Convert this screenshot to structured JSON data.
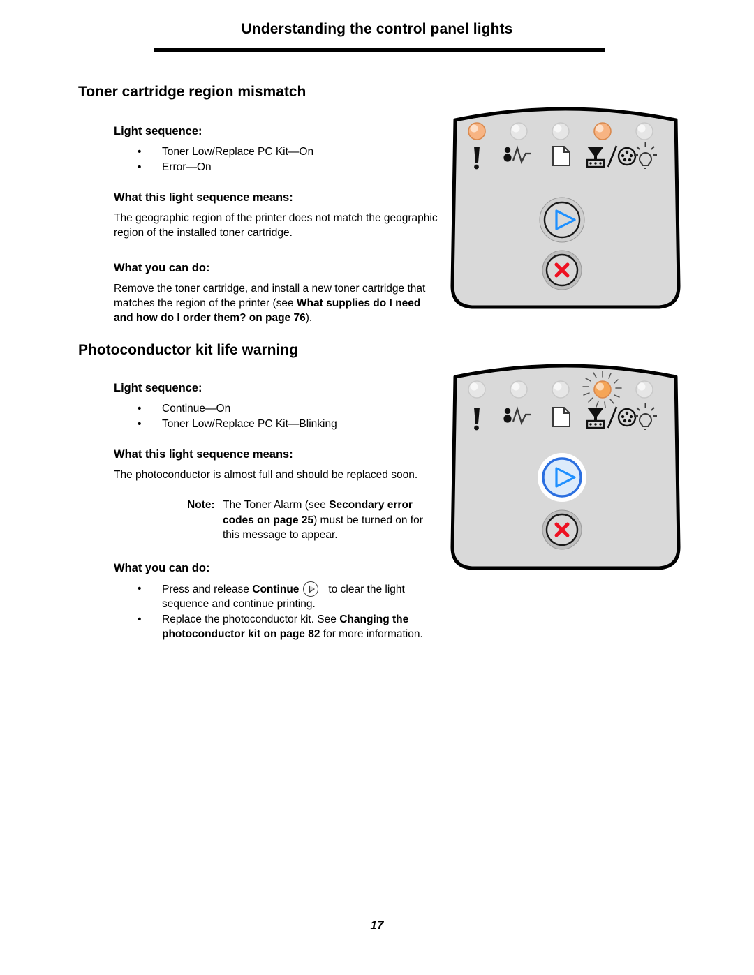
{
  "header": {
    "title": "Understanding the control panel lights"
  },
  "footer": {
    "page_number": "17"
  },
  "colors": {
    "led_on": "#F5A86A",
    "led_off": "#E8E8E8",
    "panel_face": "#D9D9D9",
    "continue_blue": "#1E90FF",
    "stop_red": "#EE1122",
    "outline": "#000000"
  },
  "sections": [
    {
      "id": "toner-cartridge-region-mismatch",
      "title": "Toner cartridge region mismatch",
      "light_sequence_heading": "Light sequence:",
      "light_sequence": [
        "Toner Low/Replace PC Kit—On",
        "Error—On"
      ],
      "means_heading": "What this light sequence means:",
      "means_text": "The geographic region of the printer does not match the geographic region of the installed toner cartridge.",
      "can_do_heading": "What you can do:",
      "can_do_text_1": "Remove the toner cartridge, and install a new toner cartridge that matches the region of the printer (see ",
      "can_do_bold": "What supplies do I need and how do I order them? on page 76",
      "can_do_text_2": ").",
      "panel": {
        "leds": [
          {
            "name": "error-led",
            "state": "on"
          },
          {
            "name": "paper-jam-led",
            "state": "off"
          },
          {
            "name": "load-paper-led",
            "state": "off"
          },
          {
            "name": "toner-low-replace-pc-kit-led",
            "state": "on"
          },
          {
            "name": "ready-led",
            "state": "off"
          }
        ],
        "continue_button_state": "normal",
        "stop_button_state": "normal"
      }
    },
    {
      "id": "photoconductor-kit-life-warning",
      "title": "Photoconductor kit life warning",
      "light_sequence_heading": "Light sequence:",
      "light_sequence": [
        "Continue—On",
        "Toner Low/Replace PC Kit—Blinking"
      ],
      "means_heading": "What this light sequence means:",
      "means_text": "The photoconductor is almost full and should be replaced soon.",
      "note": {
        "label": "Note:",
        "text_1": "The Toner Alarm (see ",
        "bold": "Secondary error codes on page 25",
        "text_2": ") must be turned on for this message to appear."
      },
      "can_do_heading": "What you can do:",
      "can_do_bullets": [
        {
          "text_1": "Press and release ",
          "bold_1": "Continue",
          "icon": "continue-button-icon",
          "text_2": "to clear the light sequence and continue printing."
        },
        {
          "text_1": "Replace the photoconductor kit. See ",
          "bold_1": "Changing the photoconductor kit on page 82",
          "text_2": " for more information."
        }
      ],
      "panel": {
        "leds": [
          {
            "name": "error-led",
            "state": "off"
          },
          {
            "name": "paper-jam-led",
            "state": "off"
          },
          {
            "name": "load-paper-led",
            "state": "off"
          },
          {
            "name": "toner-low-replace-pc-kit-led",
            "state": "blinking"
          },
          {
            "name": "ready-led",
            "state": "off"
          }
        ],
        "continue_button_state": "lit",
        "stop_button_state": "normal"
      }
    }
  ]
}
